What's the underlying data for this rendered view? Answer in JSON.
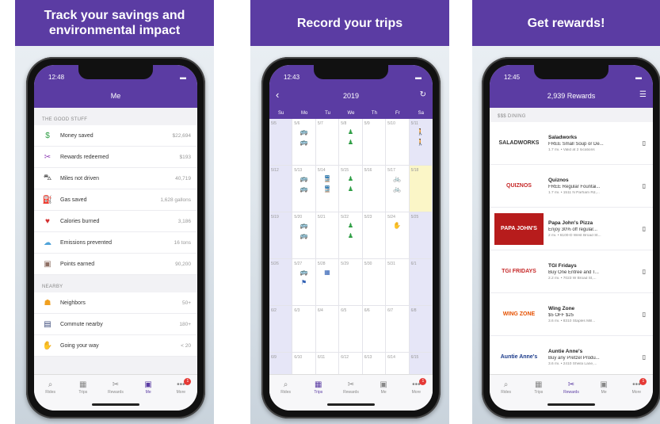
{
  "panel_me": {
    "banner": "Track your savings and environmental impact",
    "status_time": "12:48",
    "title": "Me",
    "good_section": "THE GOOD STUFF",
    "good_items": [
      {
        "icon": "dollar-icon",
        "glyph": "$",
        "color": "#2e9e44",
        "label": "Money saved",
        "value": "$22,694"
      },
      {
        "icon": "scissors-icon",
        "glyph": "✂",
        "color": "#8e3fb5",
        "label": "Rewards redeemed",
        "value": "$193"
      },
      {
        "icon": "car-icon",
        "glyph": "⛍",
        "color": "#444444",
        "label": "Miles not driven",
        "value": "40,719"
      },
      {
        "icon": "gas-pump-icon",
        "glyph": "⛽",
        "color": "#26a69a",
        "label": "Gas saved",
        "value": "1,628 gallons"
      },
      {
        "icon": "heart-icon",
        "glyph": "♥",
        "color": "#d32f2f",
        "label": "Calories burned",
        "value": "3,186"
      },
      {
        "icon": "cloud-icon",
        "glyph": "☁",
        "color": "#4fa3d9",
        "label": "Emissions prevented",
        "value": "16 tons"
      },
      {
        "icon": "wallet-icon",
        "glyph": "▣",
        "color": "#8d6e63",
        "label": "Points earned",
        "value": "90,200"
      }
    ],
    "nearby_section": "NEARBY",
    "nearby_items": [
      {
        "icon": "neighbors-icon",
        "glyph": "☗",
        "color": "#f0a020",
        "label": "Neighbors",
        "value": "50+"
      },
      {
        "icon": "commute-icon",
        "glyph": "▤",
        "color": "#3b4a7a",
        "label": "Commute nearby",
        "value": "180+"
      },
      {
        "icon": "thumbs-up-icon",
        "glyph": "✋",
        "color": "#c8935a",
        "label": "Going your way",
        "value": "< 20"
      }
    ]
  },
  "panel_trips": {
    "banner": "Record your trips",
    "status_time": "12:43",
    "title": "2019",
    "days": [
      "Su",
      "Mo",
      "Tu",
      "We",
      "Th",
      "Fr",
      "Sa"
    ],
    "weeks": [
      [
        "5/5",
        "5/6",
        "5/7",
        "5/8",
        "5/9",
        "5/10",
        "5/11"
      ],
      [
        "5/12",
        "5/13",
        "5/14",
        "5/15",
        "5/16",
        "5/17",
        "5/18"
      ],
      [
        "5/19",
        "5/20",
        "5/21",
        "5/22",
        "5/23",
        "5/24",
        "5/25"
      ],
      [
        "5/26",
        "5/27",
        "5/28",
        "5/29",
        "5/30",
        "5/31",
        "6/1"
      ],
      [
        "6/2",
        "6/3",
        "6/4",
        "6/5",
        "6/6",
        "6/7",
        "6/8"
      ],
      [
        "6/9",
        "6/10",
        "6/11",
        "6/12",
        "6/13",
        "6/14",
        "6/15"
      ]
    ]
  },
  "panel_rewards": {
    "banner": "Get rewards!",
    "status_time": "12:45",
    "title": "2,939 Rewards",
    "section": "$$$ DINING",
    "items": [
      {
        "name": "Saladworks",
        "logo": "SALADWORKS",
        "deal": "FREE Small Soup or De...",
        "meta": "1.7 mi. • Valid at 2 locations"
      },
      {
        "name": "Quiznos",
        "logo": "QUIZNOS",
        "deal": "FREE Regular Fountai...",
        "meta": "1.7 mi. • 1511 N Parham Rd,..."
      },
      {
        "name": "Papa John's Pizza",
        "logo": "PAPA JOHN'S",
        "deal": "Enjoy 30% off regular...",
        "meta": "2 mi. • 6100-D West Broad St..."
      },
      {
        "name": "TGI Fridays",
        "logo": "TGI FRIDAYS",
        "deal": "Buy One Entree and T...",
        "meta": "2.2 mi. • 7023 W Broad St,..."
      },
      {
        "name": "Wing Zone",
        "logo": "WING ZONE",
        "deal": "$5 OFF $25",
        "meta": "3.6 mi. • 8310 Staples Mill..."
      },
      {
        "name": "Auntie Anne's",
        "logo": "Auntie Anne's",
        "deal": "Buy any Pretzel Produ...",
        "meta": "3.6 mi. • 2410 Sheila Lane,..."
      }
    ]
  },
  "tabs": [
    "Rides",
    "Trips",
    "Rewards",
    "Me",
    "More"
  ],
  "more_badge": "1"
}
